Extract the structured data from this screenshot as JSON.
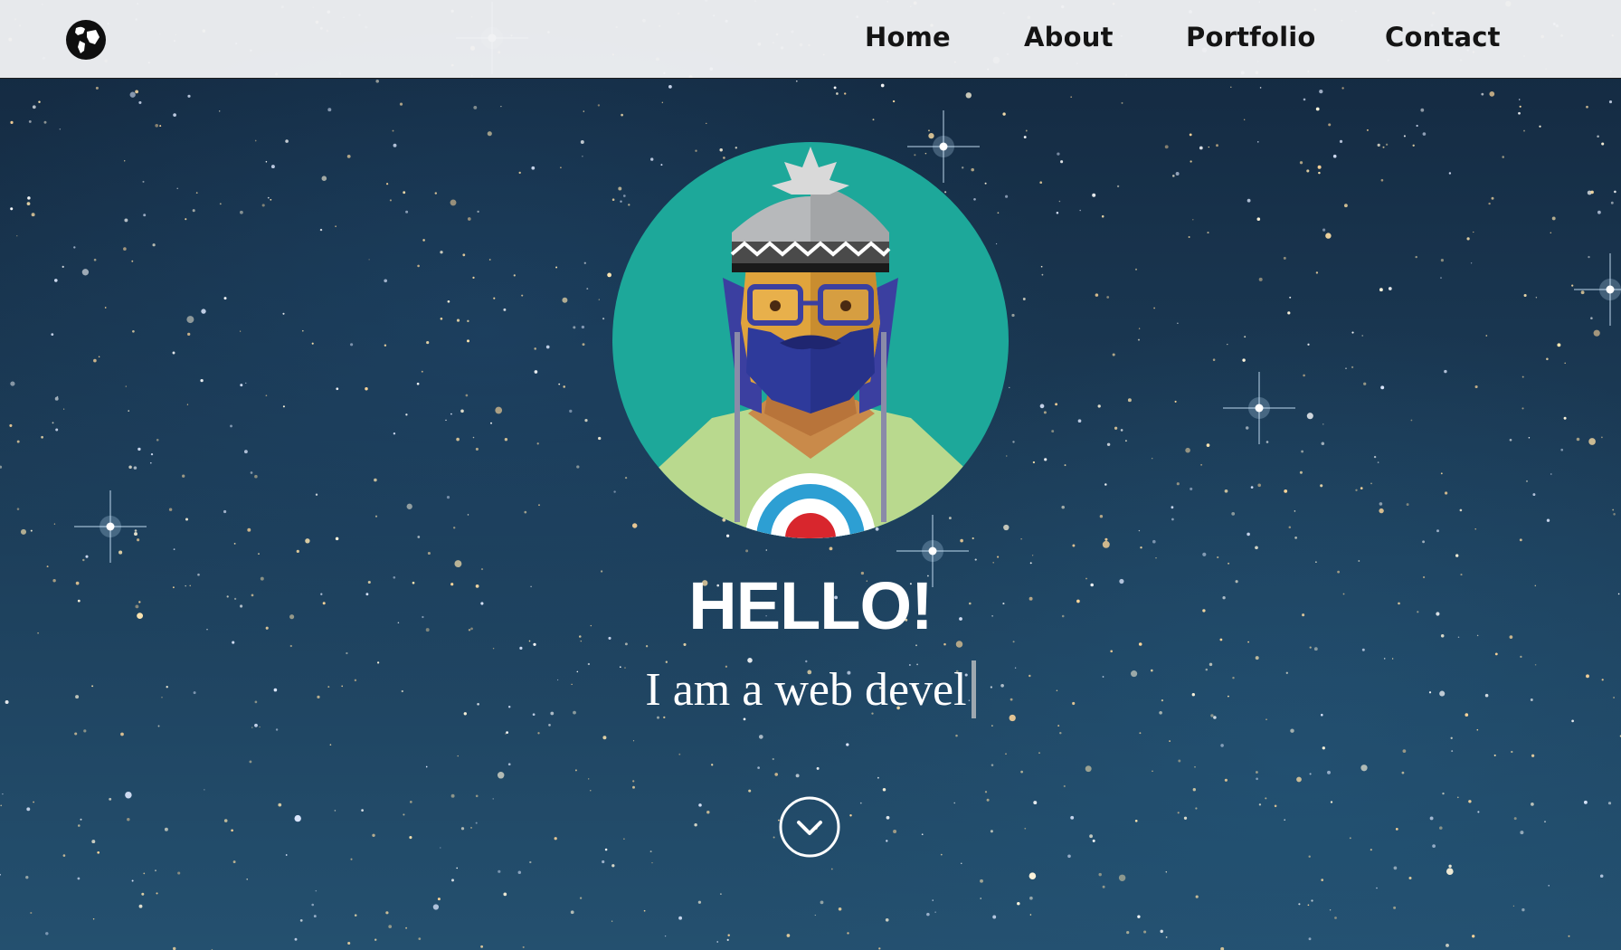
{
  "navbar": {
    "brand_icon": "globe-icon",
    "links": [
      {
        "label": "Home"
      },
      {
        "label": "About"
      },
      {
        "label": "Portfolio"
      },
      {
        "label": "Contact"
      }
    ]
  },
  "hero": {
    "avatar_icon": "hipster-avatar-illustration",
    "greeting": "HELLO!",
    "tagline": "I am a web devel",
    "scroll_icon": "chevron-down-circle-icon"
  },
  "colors": {
    "navbar_bg": "#f0f1f4",
    "nav_text": "#141414",
    "avatar_bg": "#1da89a",
    "sky": "#1b3a55",
    "text": "#ffffff"
  }
}
